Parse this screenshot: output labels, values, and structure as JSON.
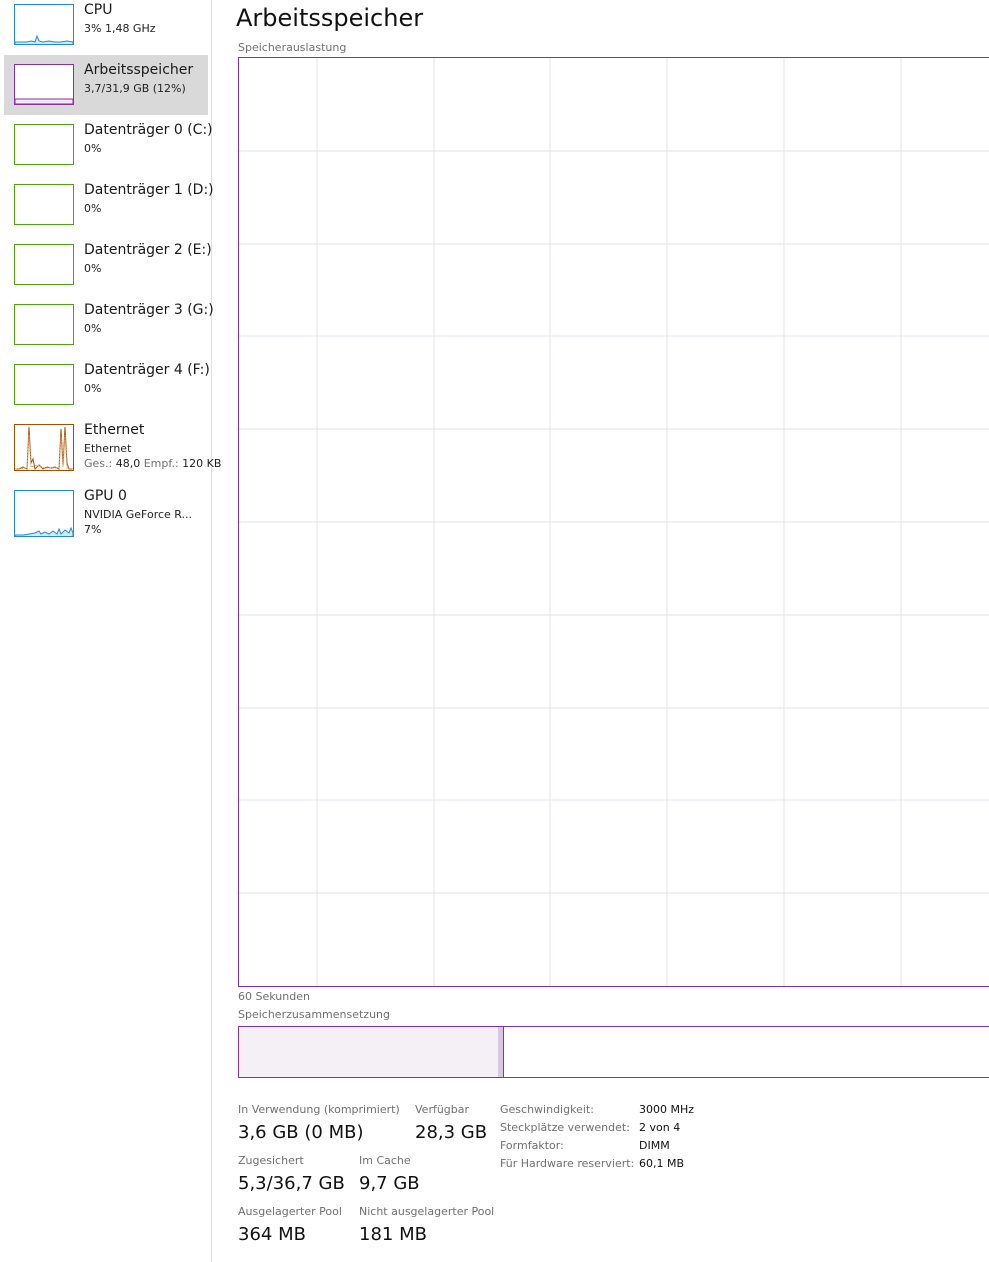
{
  "colors": {
    "cpu": "#1f8dd6",
    "memory": "#8b2fa8",
    "disk": "#4da60c",
    "ethernet": "#a74f01",
    "gpu": "#1f8dd6",
    "grid": "#e6e0ec",
    "composition_in_use": "#f4f0f6",
    "composition_modified": "#d9c7e1",
    "selected_bg": "#d9d9d9"
  },
  "sidebar": {
    "items": [
      {
        "title": "CPU",
        "sub": "3% 1,48 GHz",
        "icon": "cpu-graph-icon"
      },
      {
        "title": "Arbeitsspeicher",
        "sub": "3,7/31,9 GB (12%)",
        "icon": "memory-graph-icon",
        "selected": true
      },
      {
        "title": "Datenträger 0 (C:)",
        "sub": "0%",
        "icon": "disk-graph-icon"
      },
      {
        "title": "Datenträger 1 (D:)",
        "sub": "0%",
        "icon": "disk-graph-icon"
      },
      {
        "title": "Datenträger 2 (E:)",
        "sub": "0%",
        "icon": "disk-graph-icon"
      },
      {
        "title": "Datenträger 3 (G:)",
        "sub": "0%",
        "icon": "disk-graph-icon"
      },
      {
        "title": "Datenträger 4 (F:)",
        "sub": "0%",
        "icon": "disk-graph-icon"
      },
      {
        "title": "Ethernet",
        "sub": "Ethernet",
        "send_label": "Ges.:",
        "send_value": "48,0",
        "recv_label": "Empf.:",
        "recv_value": "120 KB",
        "icon": "ethernet-graph-icon"
      },
      {
        "title": "GPU 0",
        "sub": "NVIDIA GeForce R...",
        "sub2": "7%",
        "icon": "gpu-graph-icon"
      }
    ]
  },
  "main": {
    "title": "Arbeitsspeicher",
    "usage_caption": "Speicherauslastung",
    "time_caption": "60 Sekunden",
    "composition_caption": "Speicherzusammensetzung",
    "composition": {
      "in_use_fraction": 0.347,
      "modified_fraction": 0.006
    }
  },
  "stats": {
    "in_use_label": "In Verwendung (komprimiert)",
    "in_use_value": "3,6 GB (0 MB)",
    "available_label": "Verfügbar",
    "available_value": "28,3 GB",
    "committed_label": "Zugesichert",
    "committed_value": "5,3/36,7 GB",
    "cached_label": "Im Cache",
    "cached_value": "9,7 GB",
    "paged_label": "Ausgelagerter Pool",
    "paged_value": "364 MB",
    "nonpaged_label": "Nicht ausgelagerter Pool",
    "nonpaged_value": "181 MB",
    "details": [
      {
        "label": "Geschwindigkeit:",
        "value": "3000 MHz"
      },
      {
        "label": "Steckplätze verwendet:",
        "value": "2 von 4"
      },
      {
        "label": "Formfaktor:",
        "value": "DIMM"
      },
      {
        "label": "Für Hardware reserviert:",
        "value": "60,1 MB"
      }
    ]
  }
}
